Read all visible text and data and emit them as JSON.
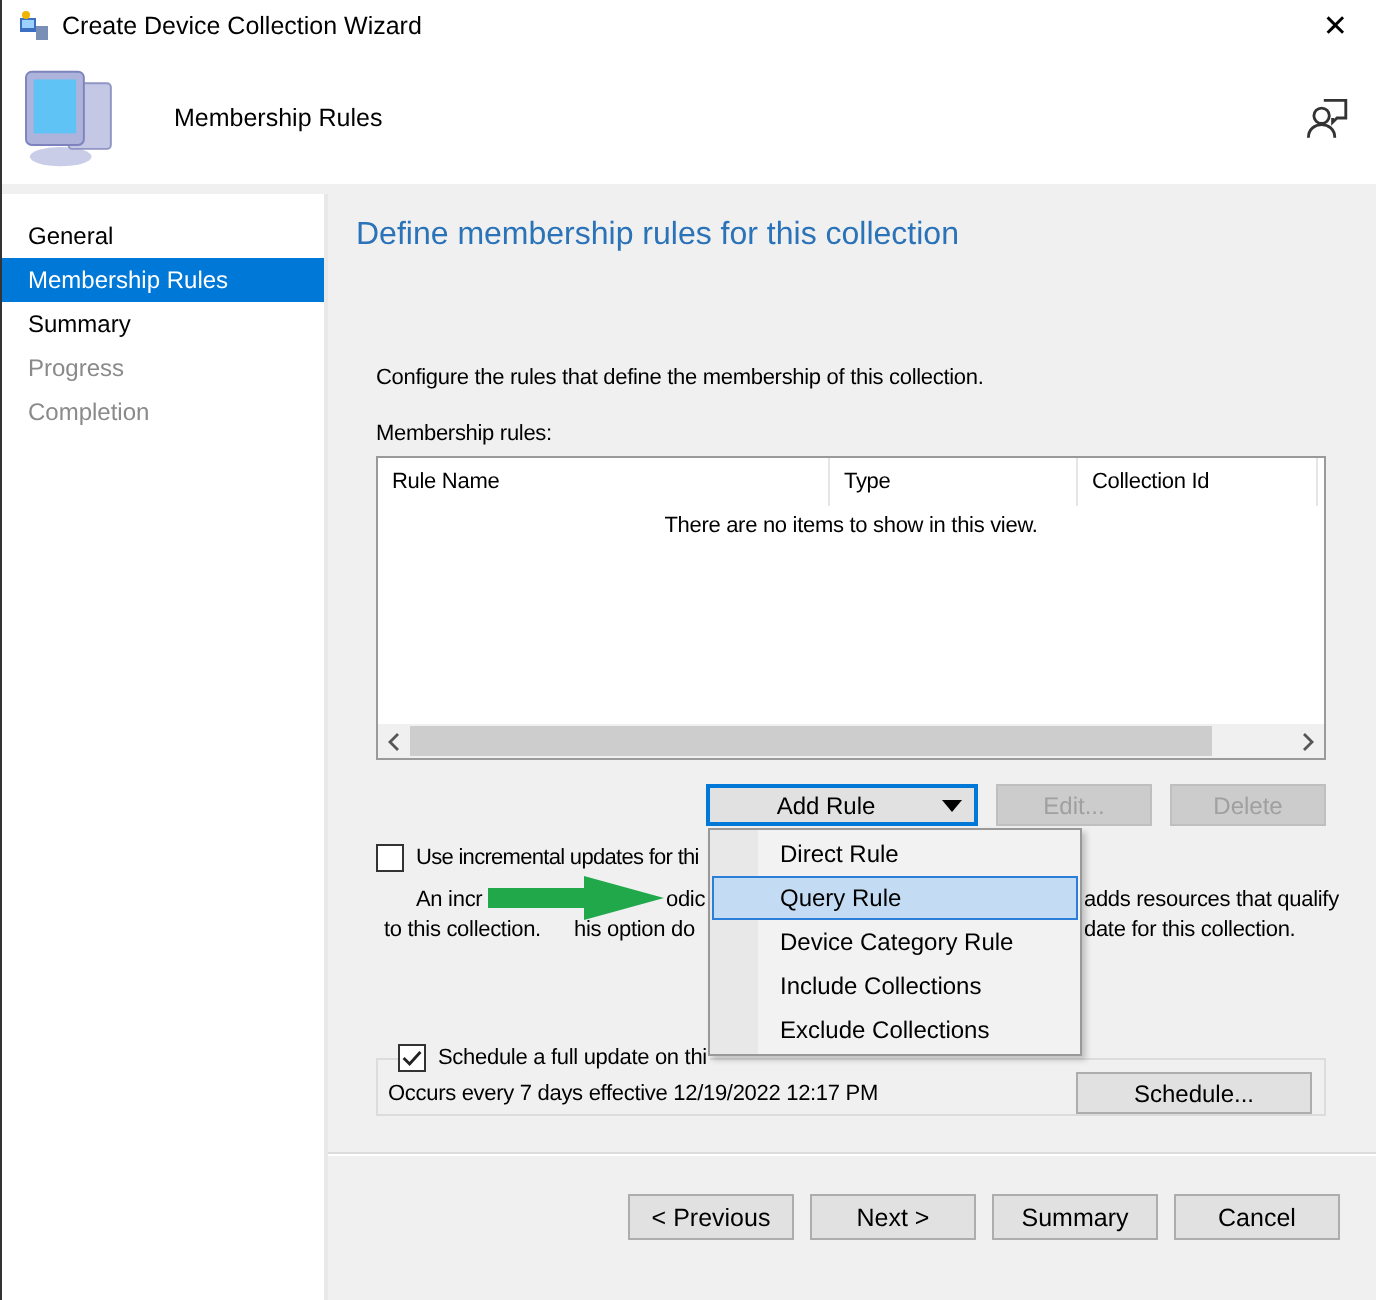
{
  "window": {
    "title": "Create Device Collection Wizard",
    "close": "✕"
  },
  "header": {
    "title": "Membership Rules"
  },
  "sidebar": {
    "items": [
      {
        "label": "General",
        "selected": false,
        "disabled": false
      },
      {
        "label": "Membership Rules",
        "selected": true,
        "disabled": false
      },
      {
        "label": "Summary",
        "selected": false,
        "disabled": false
      },
      {
        "label": "Progress",
        "selected": false,
        "disabled": true
      },
      {
        "label": "Completion",
        "selected": false,
        "disabled": true
      }
    ]
  },
  "page": {
    "heading": "Define membership rules for this collection",
    "intro": "Configure the rules that define the membership of this collection.",
    "rules_label": "Membership rules:",
    "table": {
      "columns": [
        "Rule Name",
        "Type",
        "Collection Id"
      ],
      "empty_message": "There are no items to show in this view."
    },
    "buttons": [
      {
        "label": "Add Rule",
        "kind": "dropdown",
        "disabled": false
      },
      {
        "label": "Edit...",
        "kind": "plain",
        "disabled": true
      },
      {
        "label": "Delete",
        "kind": "plain",
        "disabled": true
      }
    ],
    "incremental": {
      "label": "Use incremental updates for thi",
      "checked": false,
      "description_lines": [
        [
          "An incr",
          "odic",
          "adds resources that qualify"
        ],
        [
          "to this collection.",
          "his option do",
          "date for this collection."
        ]
      ]
    },
    "menu": {
      "items": [
        {
          "label": "Direct Rule",
          "selected": false
        },
        {
          "label": "Query Rule",
          "selected": true
        },
        {
          "label": "Device Category Rule",
          "selected": false
        },
        {
          "label": "Include Collections",
          "selected": false
        },
        {
          "label": "Exclude Collections",
          "selected": false
        }
      ]
    },
    "schedule": {
      "label": "Schedule a full update on thi",
      "checked": true,
      "summary": "Occurs every 7 days effective 12/19/2022 12:17 PM",
      "button": "Schedule..."
    }
  },
  "footer": {
    "buttons": [
      "< Previous",
      "Next >",
      "Summary",
      "Cancel"
    ]
  }
}
